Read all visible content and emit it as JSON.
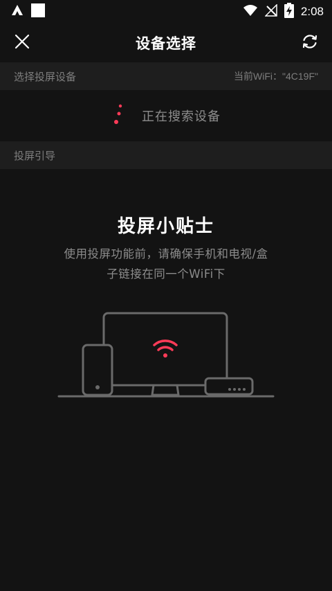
{
  "status_bar": {
    "time": "2:08",
    "icons": [
      "app-a-icon",
      "notification-square-icon",
      "wifi-icon",
      "no-signal-icon",
      "battery-charging-icon"
    ]
  },
  "header": {
    "title": "设备选择",
    "close_icon": "close-icon",
    "refresh_icon": "refresh-icon"
  },
  "device_section": {
    "label": "选择投屏设备",
    "wifi_info": "当前WiFi：\"4C19F\""
  },
  "searching": {
    "text": "正在搜索设备"
  },
  "guide_section": {
    "label": "投屏引导"
  },
  "tips": {
    "title": "投屏小贴士",
    "desc_line1": "使用投屏功能前，请确保手机和电视/盒",
    "desc_line2": "子链接在同一个WiFi下"
  },
  "colors": {
    "background": "#131313",
    "section_bg": "#1e1e1e",
    "accent": "#ff3b58",
    "muted_text": "#8c8c8c",
    "illustration_stroke": "#6a6a6a"
  }
}
